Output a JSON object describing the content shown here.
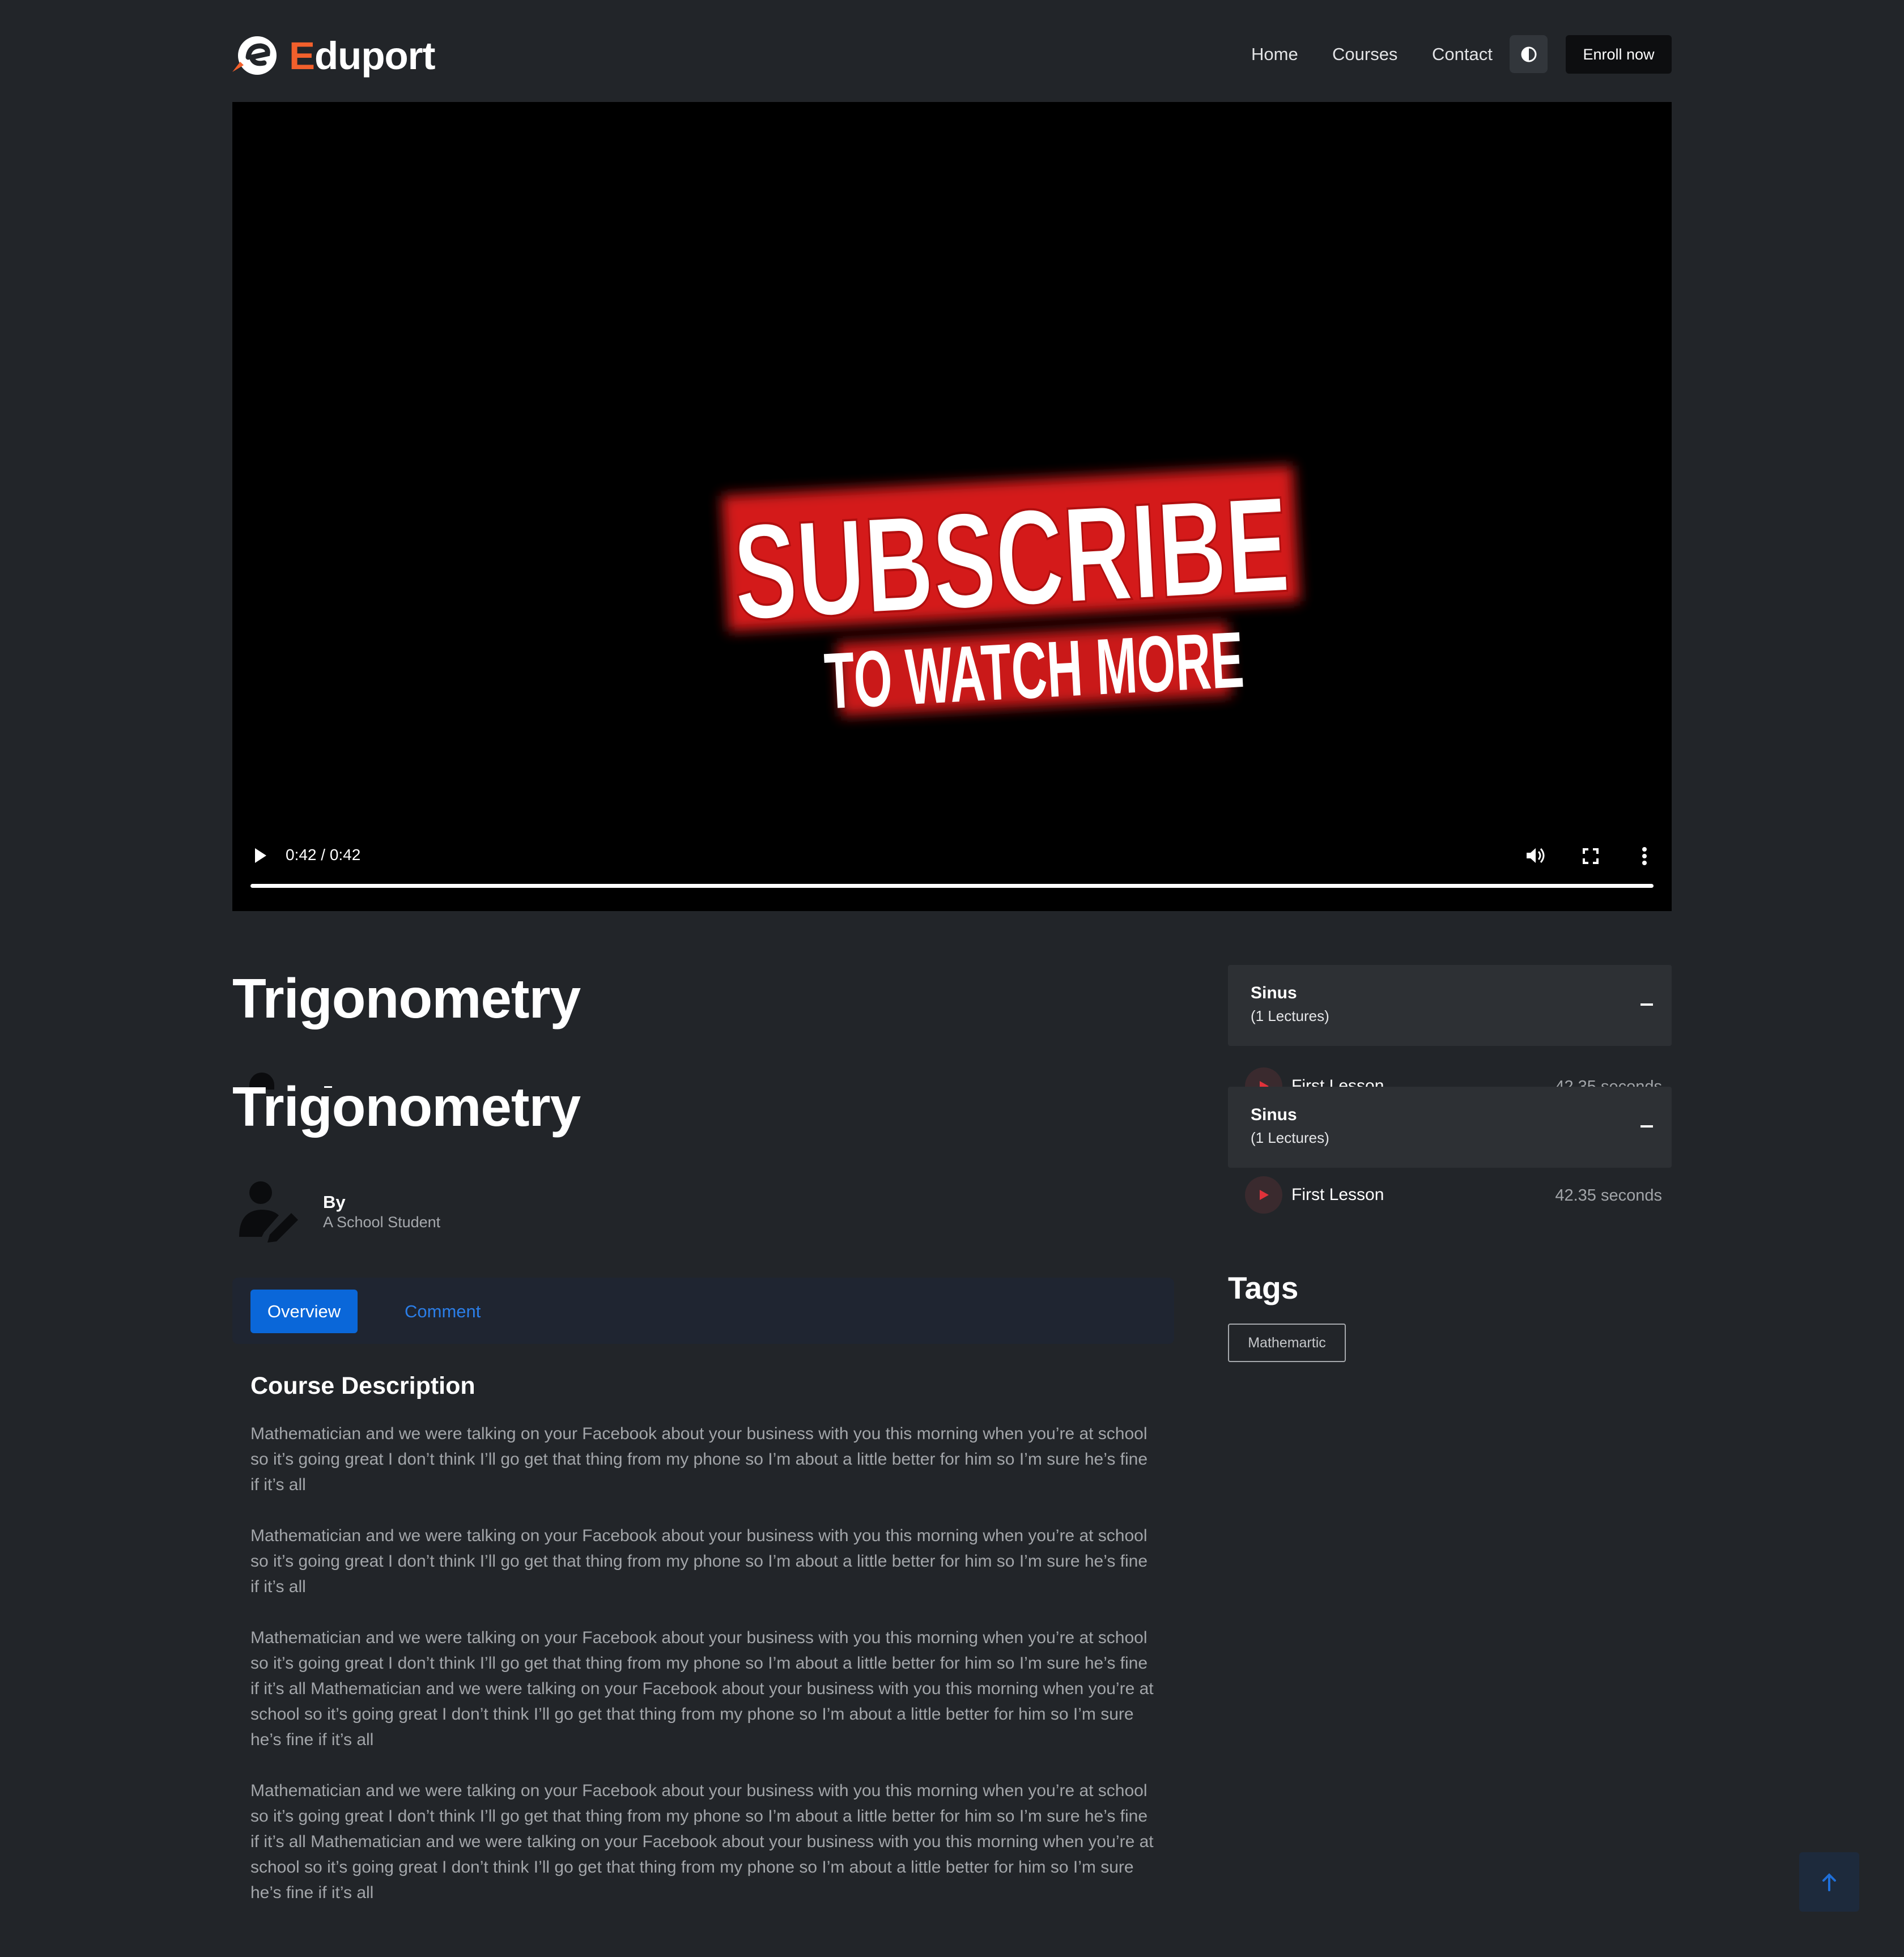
{
  "header": {
    "logo_accent": "E",
    "logo_rest": "duport",
    "nav": [
      {
        "label": "Home"
      },
      {
        "label": "Courses"
      },
      {
        "label": "Contact"
      }
    ],
    "enroll_label": "Enroll now"
  },
  "video": {
    "overlay_line1": "SUBSCRIBE",
    "overlay_line2": "TO WATCH MORE",
    "time": "0:42 / 0:42",
    "progress": 1.0
  },
  "course": {
    "title": "Trigonometry",
    "title_repeat": "Trigonometry",
    "author_label": "By",
    "author_name": "A School Student"
  },
  "tabs": [
    {
      "label": "Overview"
    },
    {
      "label": "Comment"
    }
  ],
  "description": {
    "title": "Course Description",
    "paragraphs": [
      {
        "lines": [
          "Mathematician and we were talking on your Facebook about your business with you this morning when you’re at school",
          "so it’s going great I don’t think I’ll go get that thing from my phone so I’m about a little better for him so I’m sure he’s fine",
          "if it’s all"
        ]
      },
      {
        "lines": [
          "Mathematician and we were talking on your Facebook about your business with you this morning when you’re at school",
          "so it’s going great I don’t think I’ll go get that thing from my phone so I’m about a little better for him so I’m sure he’s fine",
          "if it’s all"
        ]
      },
      {
        "lines": [
          "Mathematician and we were talking on your Facebook about your business with you this morning when you’re at school",
          "so it’s going great I don’t think I’ll go get that thing from my phone so I’m about a little better for him so I’m sure he’s fine",
          "if it’s all Mathematician and we were talking on your Facebook about your business with you this morning when you’re at",
          "school so it’s going great I don’t think I’ll go get that thing from my phone so I’m about a little better for him so I’m sure",
          "he’s fine if it’s all"
        ]
      },
      {
        "lines": [
          "Mathematician and we were talking on your Facebook about your business with you this morning when you’re at school",
          "so it’s going great I don’t think I’ll go get that thing from my phone so I’m about a little better for him so I’m sure he’s fine",
          "if it’s all Mathematician and we were talking on your Facebook about your business with you this morning when you’re at",
          "school so it’s going great I don’t think I’ll go get that thing from my phone so I’m about a little better for him so I’m sure",
          "he’s fine if it’s all"
        ]
      }
    ]
  },
  "curriculum": [
    {
      "section": "Sinus",
      "count": "(1 Lectures)",
      "lesson": "First Lesson",
      "duration": "42.35 seconds"
    },
    {
      "section": "Sinus",
      "count": "(1 Lectures)",
      "lesson": "First Lesson",
      "duration": "42.35 seconds"
    }
  ],
  "tags": {
    "title": "Tags",
    "items": [
      "Mathemartic"
    ]
  },
  "colors": {
    "background": "#222529",
    "brand_orange": "#f2602c",
    "primary_blue": "#0a67d9",
    "subscribe_red": "#e01b1b"
  },
  "icons": {
    "logo": "eduport-logo-icon",
    "theme": "contrast-icon",
    "play": "play-icon",
    "volume": "volume-icon",
    "fullscreen": "fullscreen-icon",
    "more": "more-vertical-icon",
    "author": "user-edit-icon",
    "collapse": "minus-icon",
    "lesson_play": "play-circle-icon",
    "back_to_top": "arrow-up-icon"
  }
}
